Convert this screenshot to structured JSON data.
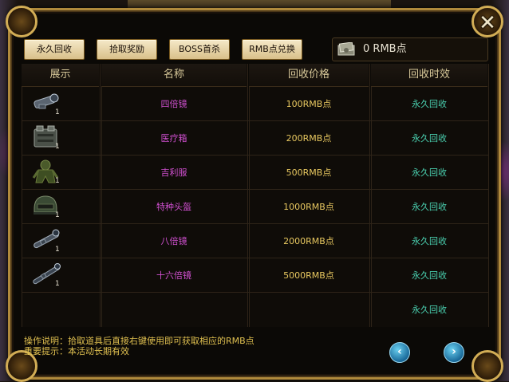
{
  "tabs": [
    "永久回收",
    "拾取奖励",
    "BOSS首杀",
    "RMB点兑换"
  ],
  "rmb": {
    "value": "0",
    "unit": "RMB点"
  },
  "headers": [
    "展示",
    "名称",
    "回收价格",
    "回收时效"
  ],
  "rows": [
    {
      "icon": "scope-4x-icon",
      "qty": "1",
      "name": "四倍镜",
      "price": "100RMB点",
      "time": "永久回收"
    },
    {
      "icon": "medkit-icon",
      "qty": "1",
      "name": "医疗箱",
      "price": "200RMB点",
      "time": "永久回收"
    },
    {
      "icon": "ghillie-suit-icon",
      "qty": "1",
      "name": "吉利服",
      "price": "500RMB点",
      "time": "永久回收"
    },
    {
      "icon": "helmet-icon",
      "qty": "1",
      "name": "特种头盔",
      "price": "1000RMB点",
      "time": "永久回收"
    },
    {
      "icon": "scope-8x-icon",
      "qty": "1",
      "name": "八倍镜",
      "price": "2000RMB点",
      "time": "永久回收"
    },
    {
      "icon": "scope-16x-icon",
      "qty": "1",
      "name": "十六倍镜",
      "price": "5000RMB点",
      "time": "永久回收"
    },
    {
      "icon": "",
      "qty": "",
      "name": "",
      "price": "",
      "time": "永久回收"
    }
  ],
  "info": {
    "line1": "操作说明：拾取道具后直接右键使用即可获取相应的RMB点",
    "line2": "重要提示：本活动长期有效"
  },
  "nav": {
    "prev": "‹",
    "next": "›"
  },
  "close": "✕"
}
